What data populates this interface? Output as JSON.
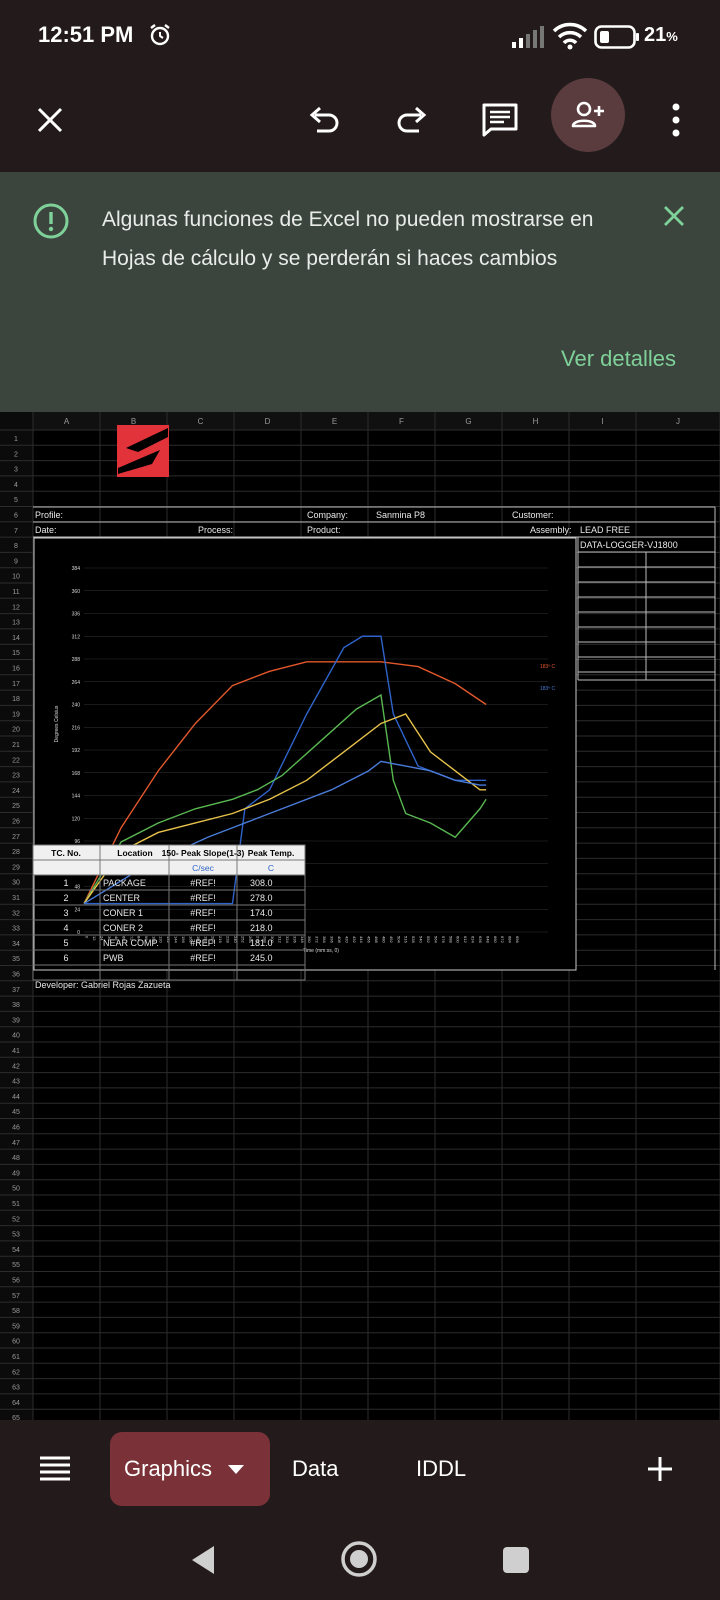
{
  "status": {
    "time": "12:51 PM",
    "battery": "21",
    "battery_unit": "%"
  },
  "banner": {
    "message": "Algunas funciones de Excel no pueden mostrarse en Hojas de cálculo y se perderán si haces cambios",
    "details_label": "Ver detalles"
  },
  "sheet": {
    "columns": [
      "A",
      "B",
      "C",
      "D",
      "E",
      "F",
      "G",
      "H",
      "I",
      "J"
    ],
    "row_count": 66,
    "cells": {
      "profile": "Profile:",
      "date": "Date:",
      "process": "Process:",
      "company": "Company:",
      "company_value": "Sanmina P8",
      "product": "Product:",
      "customer": "Customer:",
      "assembly": "Assembly:",
      "assembly_value": "LEAD FREE",
      "logger": "DATA-LOGGER-VJ1800",
      "developer": "Developer: Gabriel Rojas Zazueta"
    },
    "table": {
      "headers": [
        "TC. No.",
        "Location",
        "150- Peak Slope(1-3)",
        "Peak Temp."
      ],
      "subheaders": [
        "",
        "",
        "C/sec",
        "C"
      ],
      "rows": [
        [
          "1",
          "PACKAGE",
          "#REF!",
          "308.0"
        ],
        [
          "2",
          "CENTER",
          "#REF!",
          "278.0"
        ],
        [
          "3",
          "CONER 1",
          "#REF!",
          "174.0"
        ],
        [
          "4",
          "CONER 2",
          "#REF!",
          "218.0"
        ],
        [
          "5",
          "NEAR COMP.",
          "#REF!",
          "181.0"
        ],
        [
          "6",
          "PWB",
          "#REF!",
          "245.0"
        ]
      ]
    }
  },
  "chart_data": {
    "type": "line",
    "ylabel": "Degrees Celsius",
    "xlabel": "Time (mm:ss, 0)",
    "yticks": [
      0,
      24,
      48,
      72,
      96,
      120,
      144,
      168,
      192,
      216,
      240,
      264,
      288,
      312,
      336,
      360,
      384
    ],
    "ylim": [
      0,
      384
    ],
    "xlim": [
      0,
      750
    ],
    "annotations": [
      "183º C",
      "183º C"
    ],
    "series": [
      {
        "color": "#e2582c",
        "x": [
          0,
          60,
          120,
          180,
          240,
          300,
          360,
          420,
          480,
          540,
          600,
          650
        ],
        "y": [
          30,
          110,
          170,
          220,
          260,
          275,
          285,
          285,
          285,
          280,
          262,
          240
        ]
      },
      {
        "color": "#2f63c9",
        "x": [
          0,
          240,
          260,
          300,
          360,
          420,
          450,
          480,
          500,
          540,
          600,
          650
        ],
        "y": [
          30,
          30,
          130,
          150,
          230,
          300,
          312,
          312,
          230,
          175,
          160,
          160
        ]
      },
      {
        "color": "#59b851",
        "x": [
          0,
          60,
          120,
          180,
          240,
          280,
          320,
          380,
          440,
          480,
          500,
          520,
          560,
          600,
          640,
          650
        ],
        "y": [
          30,
          95,
          115,
          130,
          140,
          150,
          165,
          200,
          235,
          250,
          160,
          125,
          115,
          100,
          130,
          140
        ]
      },
      {
        "color": "#e8c24a",
        "x": [
          0,
          60,
          120,
          180,
          240,
          300,
          360,
          420,
          480,
          520,
          560,
          600,
          640,
          650
        ],
        "y": [
          30,
          85,
          105,
          115,
          125,
          140,
          160,
          190,
          220,
          230,
          190,
          170,
          150,
          150
        ]
      },
      {
        "color": "#4a7bd8",
        "x": [
          0,
          100,
          200,
          300,
          400,
          460,
          480,
          520,
          560,
          600,
          640,
          650
        ],
        "y": [
          30,
          70,
          100,
          125,
          150,
          170,
          180,
          175,
          170,
          160,
          155,
          155
        ]
      }
    ]
  }
}
